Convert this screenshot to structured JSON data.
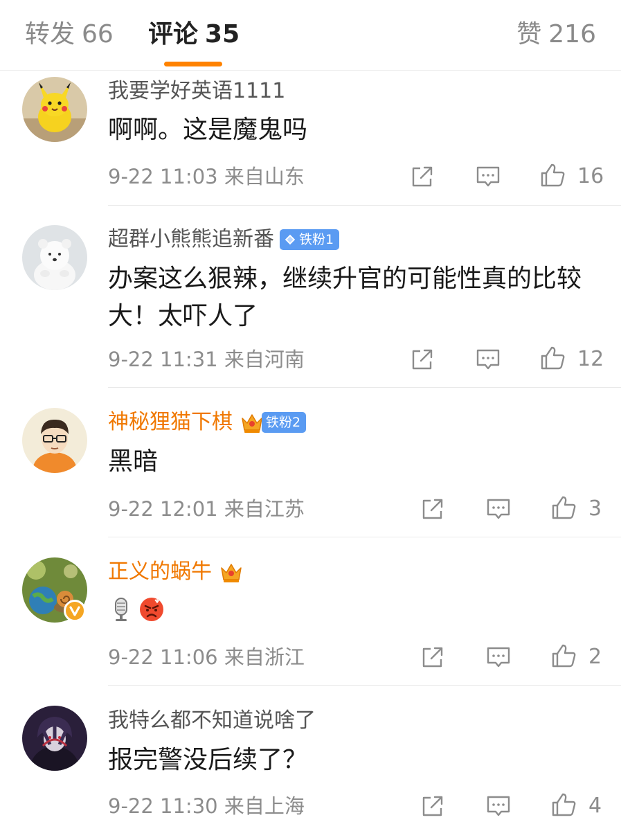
{
  "tabs": {
    "repost": {
      "label": "转发",
      "count": "66"
    },
    "comments": {
      "label": "评论",
      "count": "35"
    },
    "likes": {
      "label": "赞",
      "count": "216"
    }
  },
  "accent_color": "#ff8200",
  "comments": [
    {
      "username": "我要学好英语1111",
      "text": "啊啊。这是魔鬼吗",
      "time": "9-22 11:03",
      "location": "来自山东",
      "likes": "16"
    },
    {
      "username": "超群小熊熊追新番",
      "badge": "铁粉1",
      "text": "办案这么狠辣，继续升官的可能性真的比较大！太吓人了",
      "time": "9-22 11:31",
      "location": "来自河南",
      "likes": "12"
    },
    {
      "username": "神秘狸猫下棋",
      "badge": "铁粉2",
      "text": "黑暗",
      "time": "9-22 12:01",
      "location": "来自江苏",
      "likes": "3"
    },
    {
      "username": "正义的蜗牛",
      "emojis": [
        "microphone-emoji",
        "angry-face-emoji"
      ],
      "time": "9-22 11:06",
      "location": "来自浙江",
      "likes": "2"
    },
    {
      "username": "我特么都不知道说啥了",
      "text": "报完警没后续了？",
      "time": "9-22 11:30",
      "location": "来自上海",
      "likes": "4"
    }
  ],
  "icons": {
    "repost": "share-icon",
    "comment": "comment-icon",
    "like": "thumbs-up-icon",
    "fan_badge": "diamond-icon",
    "member": "crown-icon",
    "verified": "verified-v-icon"
  },
  "colors": {
    "vip_name": "#f07800",
    "fan_badge_bg": "#5a9bf2",
    "meta_text": "#8c8c8c"
  }
}
